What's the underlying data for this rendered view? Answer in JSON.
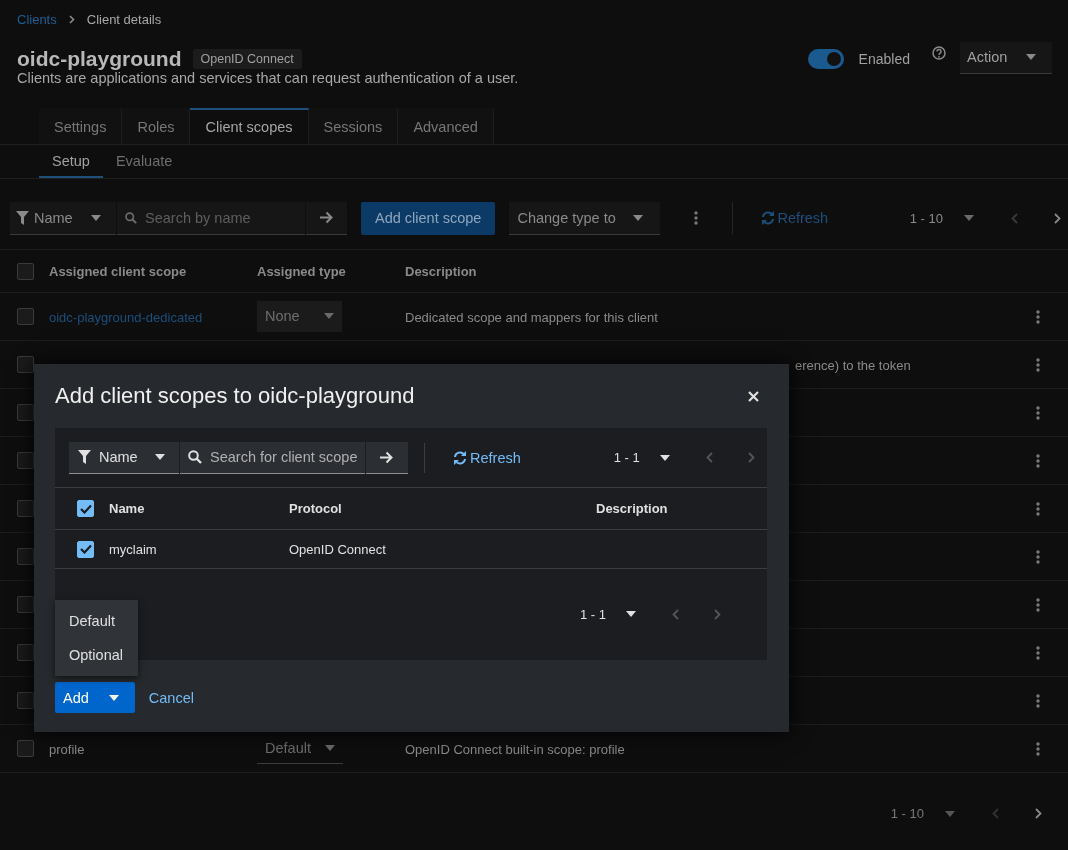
{
  "breadcrumb": [
    {
      "label": "Clients",
      "kind": "link"
    },
    {
      "label": "Client details",
      "kind": "current"
    }
  ],
  "header": {
    "title": "oidc-playground",
    "badge": "OpenID Connect",
    "description": "Clients are applications and services that can request authentication of a user.",
    "enabled_switch": {
      "label": "Enabled",
      "on": true
    },
    "action_menu": "Action"
  },
  "tabs": [
    {
      "label": "Settings",
      "selected": false
    },
    {
      "label": "Roles",
      "selected": false
    },
    {
      "label": "Client scopes",
      "selected": true
    },
    {
      "label": "Sessions",
      "selected": false
    },
    {
      "label": "Advanced",
      "selected": false
    }
  ],
  "subtabs": [
    {
      "label": "Setup",
      "selected": true
    },
    {
      "label": "Evaluate",
      "selected": false
    }
  ],
  "toolbar": {
    "filter": "Name",
    "search_placeholder": "Search by name",
    "add_button": "Add client scope",
    "change_type": "Change type to",
    "refresh": "Refresh",
    "pagination": "1 - 10"
  },
  "table": {
    "all_selected": false,
    "columns": [
      "Assigned client scope",
      "Assigned type",
      "Description"
    ],
    "rows": [
      {
        "selected": false,
        "name": "oidc-playground-dedicated",
        "assigned_type": "None",
        "description": "Dedicated scope and mappers for this client"
      },
      {
        "selected": false,
        "description": "erence) to the token"
      },
      {
        "selected": false
      },
      {
        "selected": false
      },
      {
        "selected": false
      },
      {
        "selected": false
      },
      {
        "selected": false
      },
      {
        "selected": false
      },
      {
        "selected": false
      },
      {
        "selected": false,
        "name": "profile",
        "assigned_type": "Default",
        "description": "OpenID Connect built-in scope: profile"
      }
    ]
  },
  "pagination_bottom": "1 - 10",
  "modal": {
    "title": "Add client scopes to oidc-playground",
    "filter": "Name",
    "search_placeholder": "Search for client scope",
    "refresh": "Refresh",
    "pagination": "1 - 1",
    "all_checked": true,
    "columns": [
      "Name",
      "Protocol",
      "Description"
    ],
    "rows": [
      {
        "selected": true,
        "name": "myclaim",
        "protocol": "OpenID Connect"
      }
    ],
    "pagination_bottom": "1 - 1",
    "add_button": "Add",
    "cancel": "Cancel",
    "menu": [
      {
        "label": "Default"
      },
      {
        "label": "Optional"
      }
    ]
  }
}
